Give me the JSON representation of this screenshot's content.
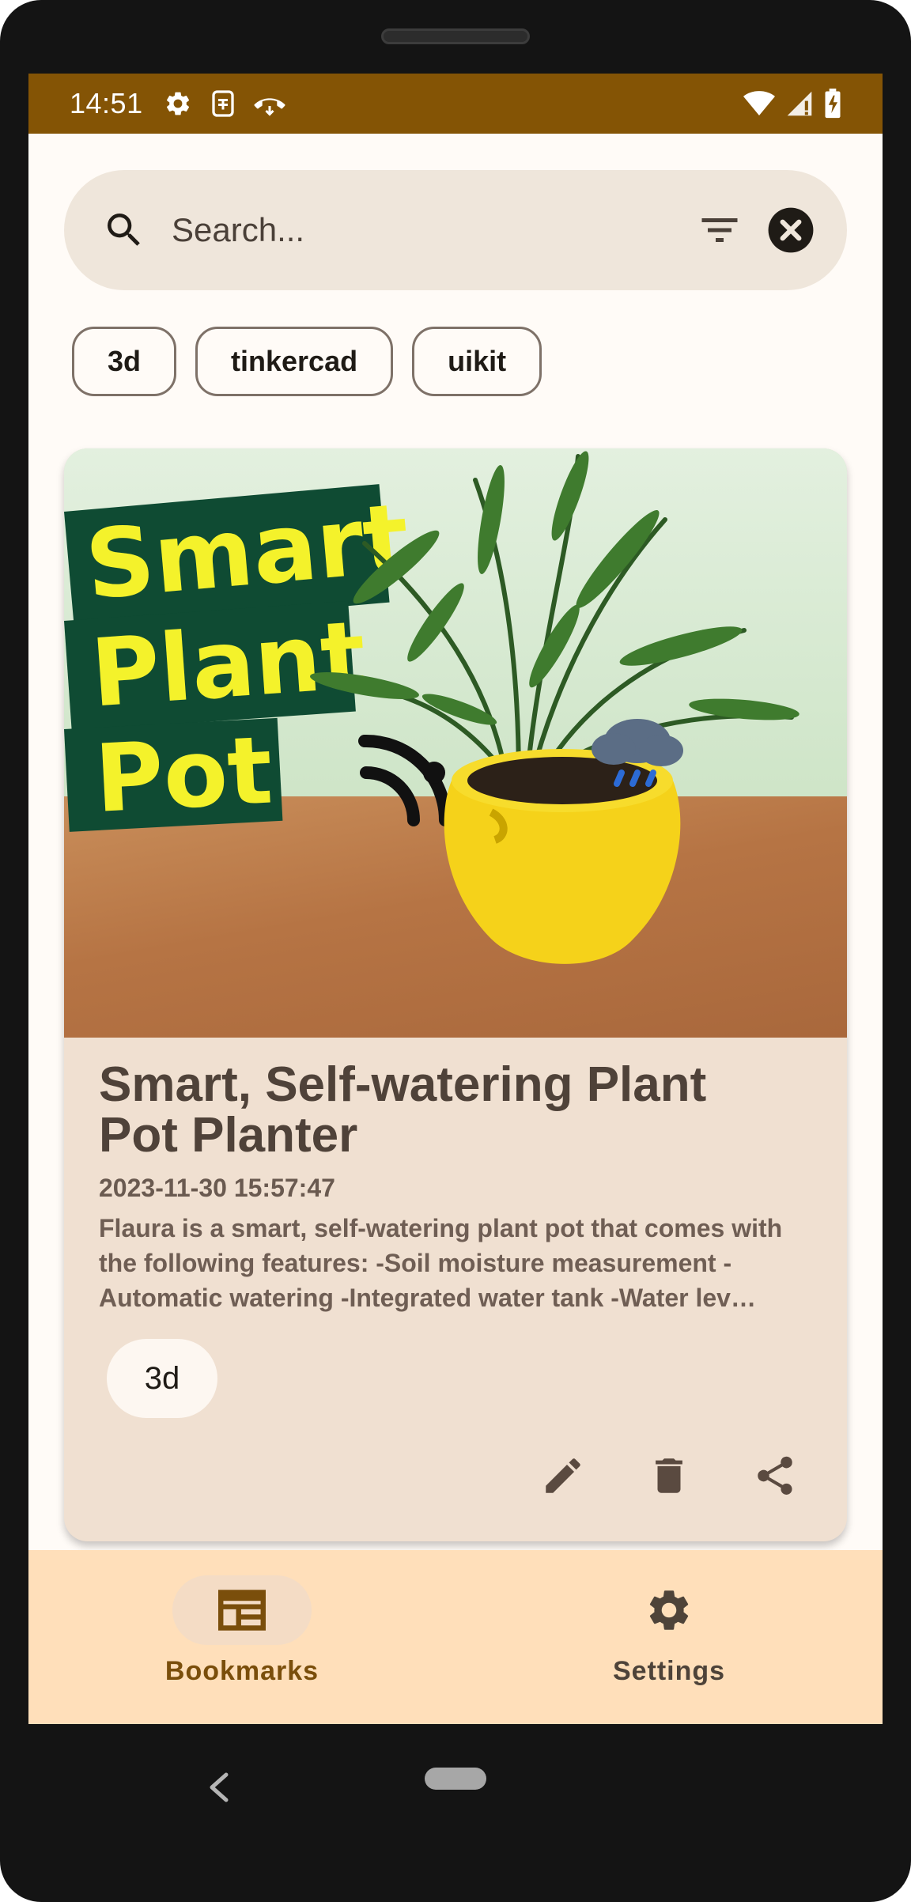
{
  "status_bar": {
    "time": "14:51",
    "left_icons": [
      "gear-icon",
      "sim-card-icon",
      "call-end-icon"
    ],
    "right_icons": [
      "wifi-icon",
      "signal-icon",
      "battery-charging-icon"
    ]
  },
  "search": {
    "placeholder": "Search...",
    "value": ""
  },
  "filter_tags": [
    "3d",
    "tinkercad",
    "uikit"
  ],
  "bookmark": {
    "image_text_lines": [
      "Smart",
      "Plant",
      "Pot"
    ],
    "title": "Smart, Self-watering Plant Pot Planter",
    "date": "2023-11-30 15:57:47",
    "description": "Flaura is a smart, self-watering plant pot that comes with the following features: -Soil moisture measurement -Automatic watering -Integrated water tank -Water lev…",
    "tags": [
      "3d"
    ],
    "actions": [
      "edit-icon",
      "delete-icon",
      "share-icon"
    ]
  },
  "bottom_nav": {
    "items": [
      {
        "label": "Bookmarks",
        "icon": "bookmarks-icon",
        "active": true
      },
      {
        "label": "Settings",
        "icon": "settings-icon",
        "active": false
      }
    ]
  },
  "colors": {
    "status_bar": "#845405",
    "accent": "#7a4e0b",
    "card_bg": "#f0e0d1",
    "nav_bg": "#ffdfba",
    "search_bg": "#efe6db"
  }
}
